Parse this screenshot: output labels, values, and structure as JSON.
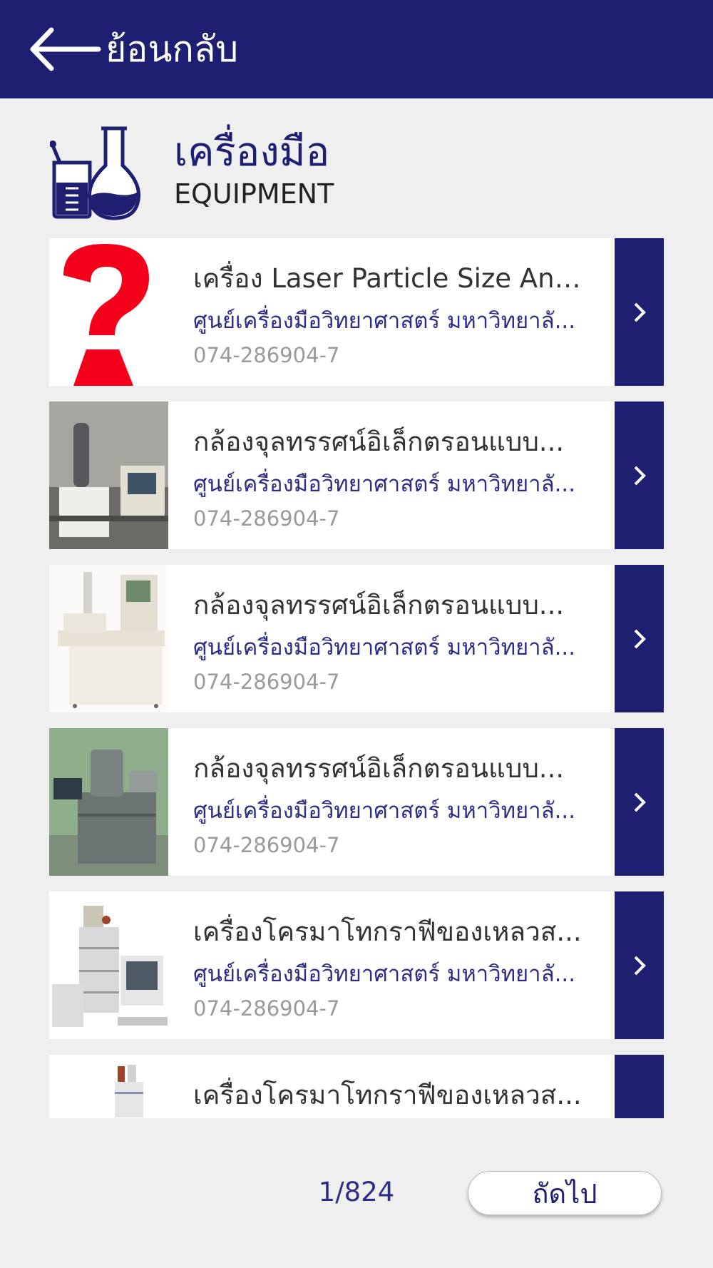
{
  "header": {
    "back_label": "ย้อนกลับ"
  },
  "section": {
    "title": "เครื่องมือ",
    "subtitle": "EQUIPMENT"
  },
  "items": [
    {
      "title": "เครื่อง Laser Particle Size Ana...",
      "org": "ศูนย์เครื่องมือวิทยาศาสตร์ มหาวิทยาลั...",
      "phone": "074-286904-7"
    },
    {
      "title": "กล้องจุลทรรศน์อิเล็กตรอนแบบ...",
      "org": "ศูนย์เครื่องมือวิทยาศาสตร์ มหาวิทยาลั...",
      "phone": "074-286904-7"
    },
    {
      "title": "กล้องจุลทรรศน์อิเล็กตรอนแบบ...",
      "org": "ศูนย์เครื่องมือวิทยาศาสตร์ มหาวิทยาลั...",
      "phone": "074-286904-7"
    },
    {
      "title": "กล้องจุลทรรศน์อิเล็กตรอนแบบ...",
      "org": "ศูนย์เครื่องมือวิทยาศาสตร์ มหาวิทยาลั...",
      "phone": "074-286904-7"
    },
    {
      "title": "เครื่องโครมาโทกราฟีของเหลวส...",
      "org": "ศูนย์เครื่องมือวิทยาศาสตร์ มหาวิทยาลั...",
      "phone": "074-286904-7"
    },
    {
      "title": "เครื่องโครมาโทกราฟีของเหลวส...",
      "org": "",
      "phone": ""
    }
  ],
  "pager": {
    "indicator": "1/824",
    "next_label": "ถัดไป"
  },
  "colors": {
    "primary": "#1f1f72",
    "accent_text": "#2d2d88",
    "background": "#efefef"
  }
}
